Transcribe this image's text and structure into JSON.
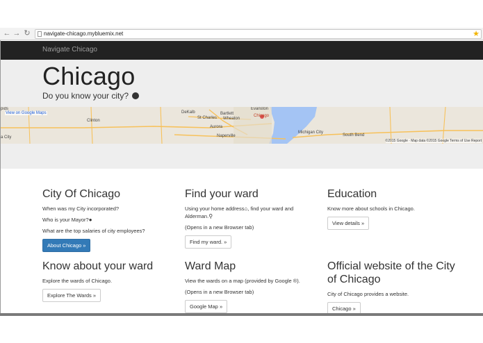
{
  "browser": {
    "url": "navigate-chicago.mybluemix.net"
  },
  "navbar": {
    "brand": "Navigate Chicago"
  },
  "jumbotron": {
    "title": "Chicago",
    "tagline": "Do you know your city?"
  },
  "map": {
    "view_link": "View on Google Maps",
    "footer": "©2015 Google · Map data ©2015 Google   Terms of Use   Report",
    "labels": {
      "l1": "pids",
      "l2": "Clinton",
      "l3": "DeKalb",
      "l4": "St Charles",
      "l5": "Bartlett",
      "l6": "Wheaton",
      "l7": "Aurora",
      "l8": "Naperville",
      "l9": "Evanston",
      "l10": "Chicago",
      "l11": "Michigan City",
      "l12": "South Bend",
      "l13": "a City"
    },
    "colors": {
      "water": "#a4c4f4",
      "road": "#f7c15a",
      "land": "#ebe6dc"
    }
  },
  "sections": {
    "city": {
      "heading": "City Of Chicago",
      "line1": "When was my City incorporated?",
      "line2": "Who is your Mayor?",
      "line3": "What are the top salaries of city employees?",
      "button": "About Chicago »"
    },
    "ward": {
      "heading": "Find your ward",
      "line1a": "Using your home address",
      "line1b": ", find your ward and",
      "line1c": "Alderman.",
      "line2": "(Opens in a new Browser tab)",
      "button": "Find my ward. »"
    },
    "education": {
      "heading": "Education",
      "line1": "Know more about schools in Chicago.",
      "button": "View details »"
    },
    "know_ward": {
      "heading": "Know about your ward",
      "line1": "Explore the wards of Chicago.",
      "button": "Explore The Wards »"
    },
    "ward_map": {
      "heading": "Ward Map",
      "line1": "View the wards on a map (provided by Google ®).",
      "line2": "(Opens in a new Browser tab)",
      "button": "Google Map »"
    },
    "official": {
      "heading": "Official website of the City of Chicago",
      "line1": "City of Chicago provides a website.",
      "button": "Chicago »"
    }
  },
  "icons": {
    "back": "back-arrow-icon",
    "forward": "forward-arrow-icon",
    "reload": "reload-icon",
    "bookmark": "star-icon",
    "globe": "globe-icon",
    "user": "user-icon",
    "home": "home-icon",
    "search": "search-icon"
  }
}
